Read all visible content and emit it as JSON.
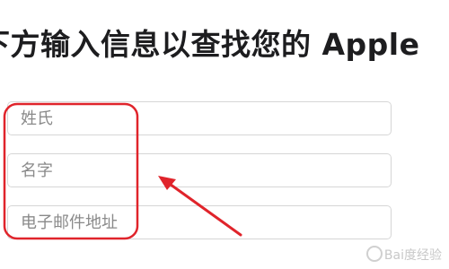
{
  "heading": "下方输入信息以查找您的 Apple",
  "form": {
    "last_name_placeholder": "姓氏",
    "first_name_placeholder": "名字",
    "email_placeholder": "电子邮件地址"
  },
  "annotation": {
    "color": "#e0242b"
  },
  "watermark": {
    "text": "Bai度经验"
  }
}
